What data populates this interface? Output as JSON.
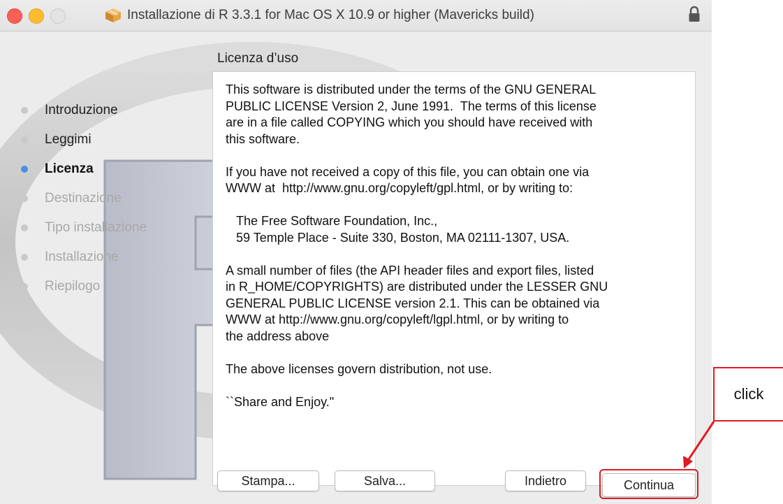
{
  "window": {
    "title": "Installazione di R 3.3.1 for Mac OS X 10.9 or higher (Mavericks build)"
  },
  "sidebar": {
    "items": [
      {
        "label": "Introduzione"
      },
      {
        "label": "Leggimi"
      },
      {
        "label": "Licenza"
      },
      {
        "label": "Destinazione"
      },
      {
        "label": "Tipo installazione"
      },
      {
        "label": "Installazione"
      },
      {
        "label": "Riepilogo"
      }
    ]
  },
  "main": {
    "section_title": "Licenza d’uso",
    "license_text": "This software is distributed under the terms of the GNU GENERAL\nPUBLIC LICENSE Version 2, June 1991.  The terms of this license\nare in a file called COPYING which you should have received with\nthis software.\n\nIf you have not received a copy of this file, you can obtain one via\nWWW at  http://www.gnu.org/copyleft/gpl.html, or by writing to:\n\n   The Free Software Foundation, Inc.,\n   59 Temple Place - Suite 330, Boston, MA 02111-1307, USA.\n\nA small number of files (the API header files and export files, listed\nin R_HOME/COPYRIGHTS) are distributed under the LESSER GNU\nGENERAL PUBLIC LICENSE version 2.1. This can be obtained via\nWWW at http://www.gnu.org/copyleft/lgpl.html, or by writing to\nthe address above\n\nThe above licenses govern distribution, not use.\n\n``Share and Enjoy.\""
  },
  "buttons": {
    "print": "Stampa...",
    "save": "Salva...",
    "back": "Indietro",
    "continue": "Continua"
  },
  "annotation": {
    "label": "click"
  },
  "colors": {
    "current_step_dot": "#4a90e2",
    "annotation_red": "#e01b24"
  }
}
